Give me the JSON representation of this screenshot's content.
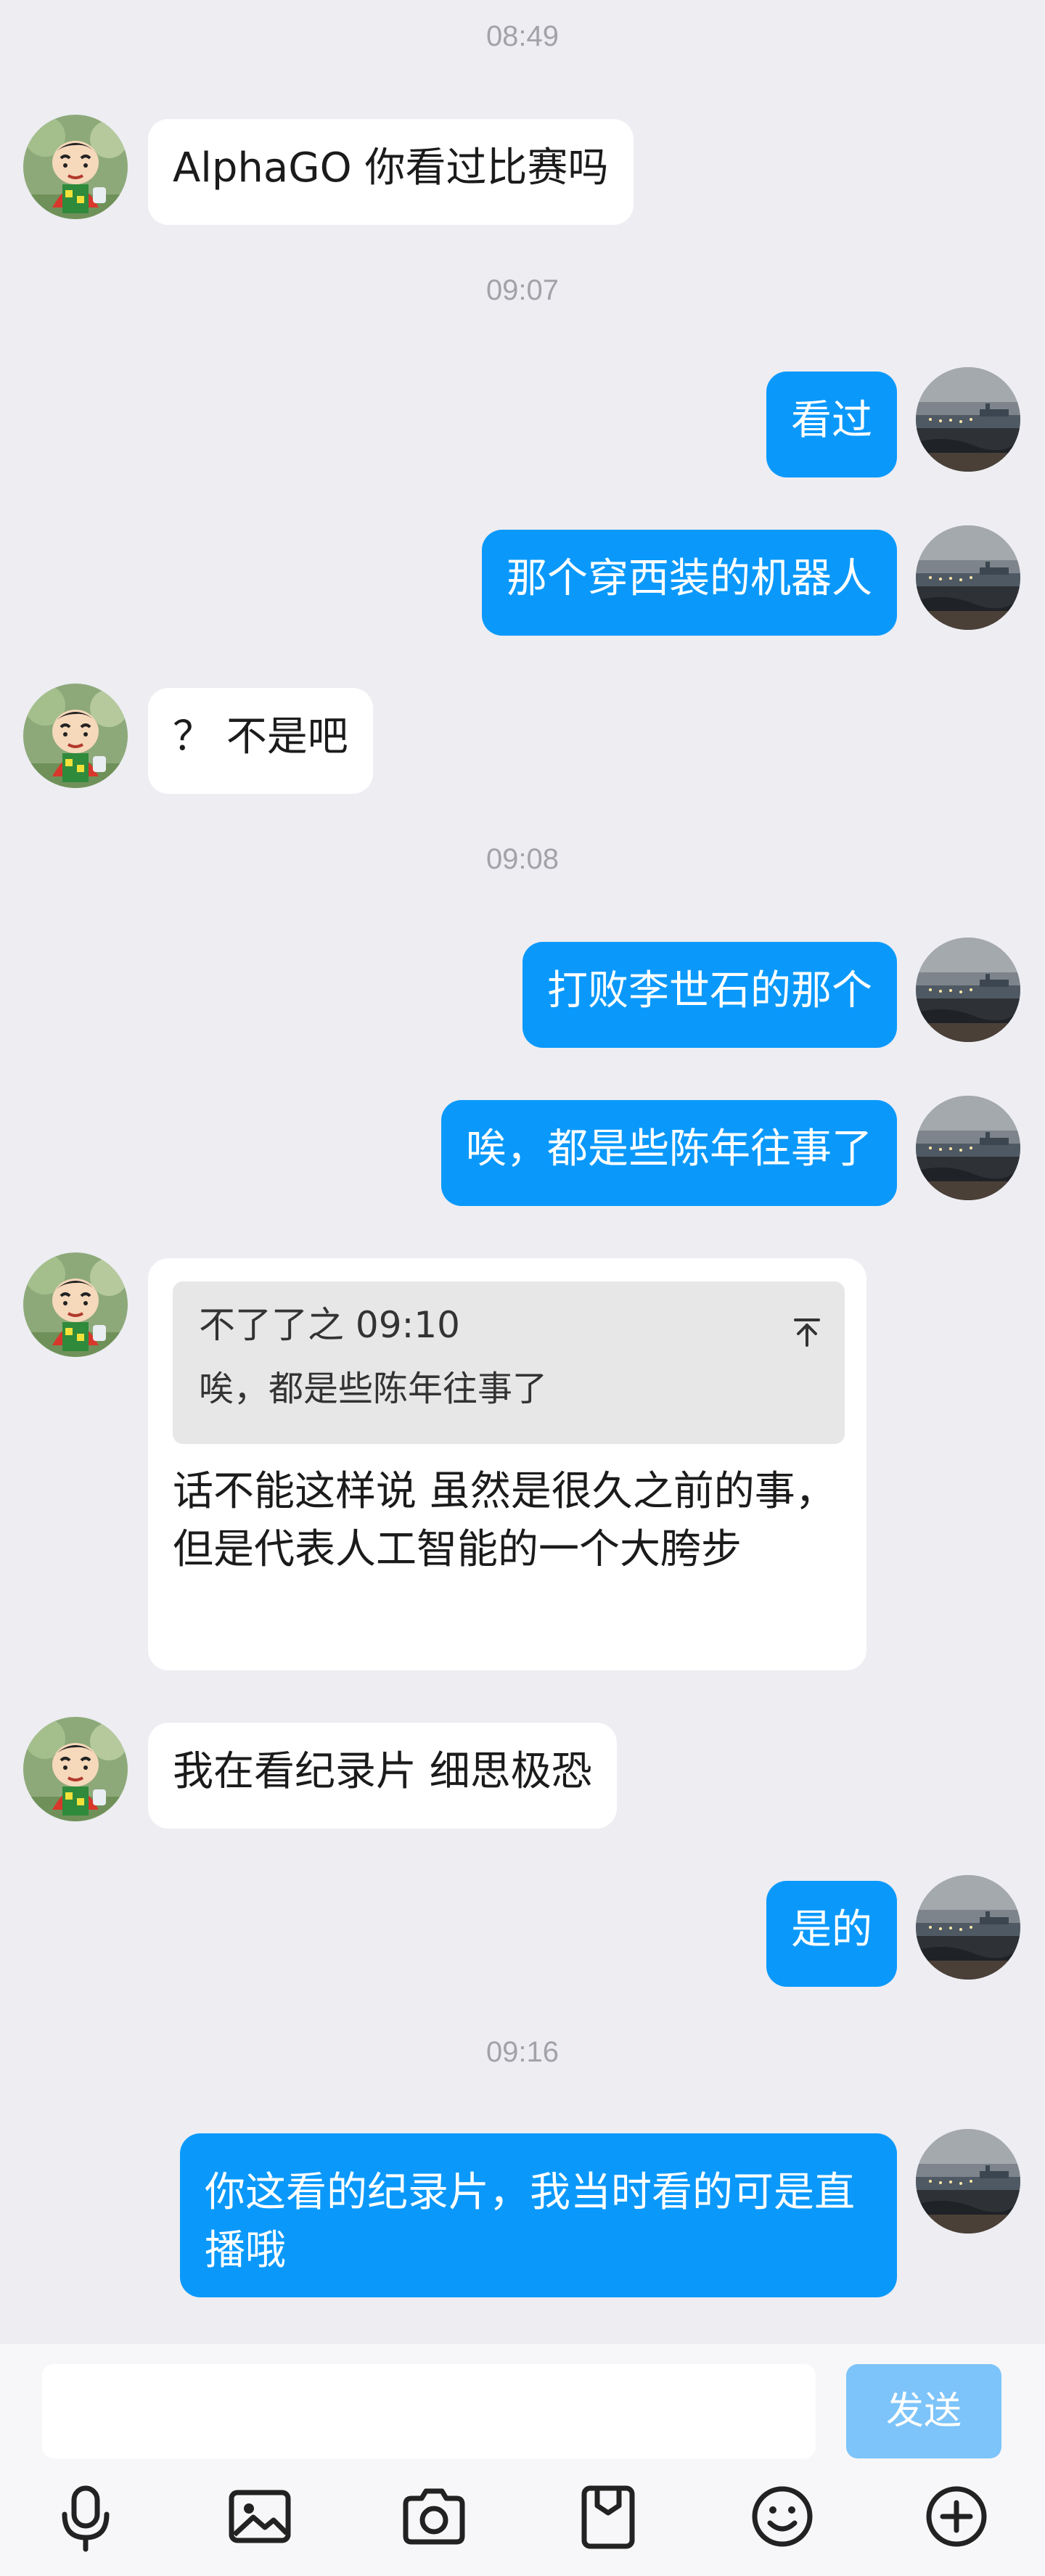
{
  "timestamps": [
    "08:49",
    "09:07",
    "09:08",
    "09:16"
  ],
  "messages": [
    {
      "text": "AlphaGO 你看过比赛吗"
    },
    {
      "text": "看过"
    },
    {
      "text": "那个穿西装的机器人"
    },
    {
      "text": "？ 不是吧"
    },
    {
      "text": "打败李世石的那个"
    },
    {
      "text": "唉，都是些陈年往事了"
    },
    {
      "quote": {
        "author_time": "不了了之 09:10",
        "text": "唉，都是些陈年往事了",
        "icon": "jump-to-top-icon"
      },
      "text": "话不能这样说 虽然是很久之前的事，但是代表人工智能的一个大胯步"
    },
    {
      "text": "我在看纪录片 细思极恐"
    },
    {
      "text": "是的"
    },
    {
      "text": "你这看的纪录片，我当时看的可是直播哦"
    }
  ],
  "composer": {
    "input_value": "",
    "send_label": "发送"
  },
  "toolbar": {
    "icons": [
      "microphone-icon",
      "image-icon",
      "camera-icon",
      "file-icon",
      "emoji-icon",
      "plus-icon"
    ]
  },
  "colors": {
    "background": "#ededf2",
    "outgoing_bubble": "#0a99fb",
    "incoming_bubble": "#ffffff",
    "send_button_disabled": "#7cc4fa",
    "timestamp": "#a2a2a8"
  }
}
